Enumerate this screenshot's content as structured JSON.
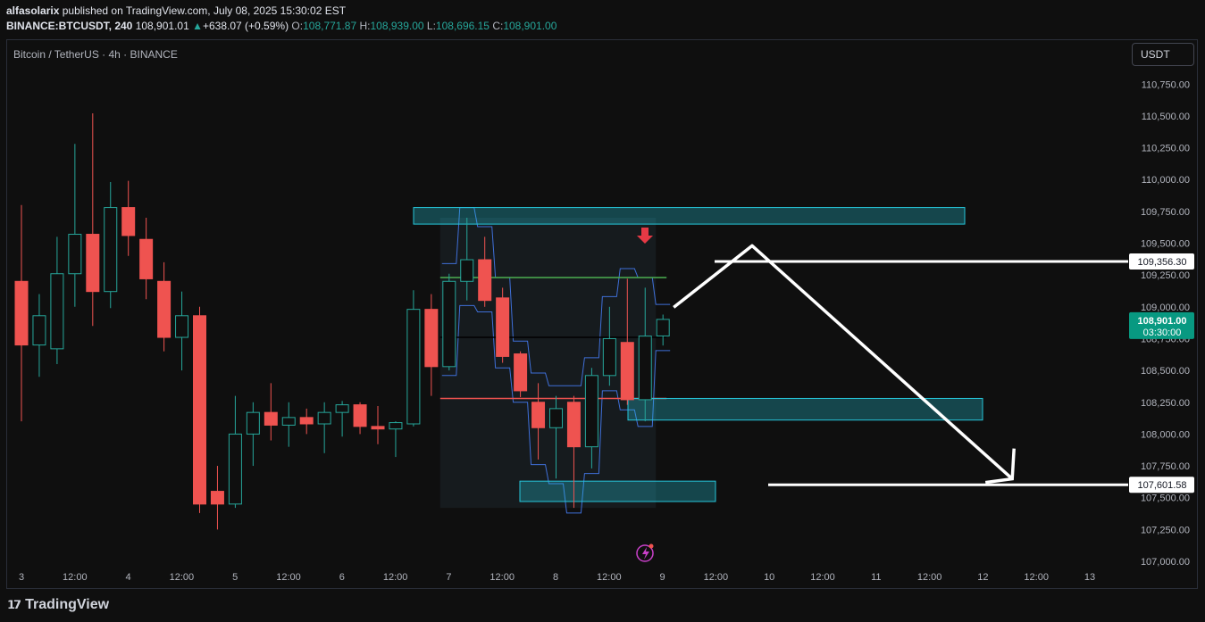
{
  "header": {
    "author": "alfasolarix",
    "published": "published on TradingView.com, July 08, 2025 15:30:02 EST",
    "symbol": "BINANCE:BTCUSDT, 240",
    "last": "108,901.01",
    "change": "+638.07 (+0.59%)",
    "o_label": "O:",
    "o": "108,771.87",
    "h_label": "H:",
    "h": "108,939.00",
    "l_label": "L:",
    "l": "108,696.15",
    "c_label": "C:",
    "c": "108,901.00"
  },
  "symbol_title": "Bitcoin / TetherUS · 4h · BINANCE",
  "currency_button": "USDT",
  "footer": {
    "brand": "TradingView"
  },
  "colors": {
    "up": "#26a69a",
    "down": "#ef5350",
    "zone": "#26c6da",
    "arrow": "#ffffff"
  },
  "chart_data": {
    "type": "candlestick",
    "ylim": [
      107000,
      110850
    ],
    "y_ticks": [
      107000,
      107250,
      107500,
      107750,
      108000,
      108250,
      108500,
      108750,
      109000,
      109250,
      109500,
      109750,
      110000,
      110250,
      110500,
      110750
    ],
    "y_tick_labels": [
      "107,000.00",
      "107,250.00",
      "107,500.00",
      "107,750.00",
      "108,000.00",
      "108,250.00",
      "108,500.00",
      "108,750.00",
      "109,000.00",
      "109,250.00",
      "109,500.00",
      "109,750.00",
      "110,000.00",
      "110,250.00",
      "110,500.00",
      "110,750.00"
    ],
    "x_ticks": [
      "3",
      "12:00",
      "4",
      "12:00",
      "5",
      "12:00",
      "6",
      "12:00",
      "7",
      "12:00",
      "8",
      "12:00",
      "9",
      "12:00",
      "10",
      "12:00",
      "11",
      "12:00",
      "12",
      "12:00",
      "13"
    ],
    "candles": [
      {
        "o": 109200,
        "h": 109800,
        "l": 108100,
        "c": 108700
      },
      {
        "o": 108700,
        "h": 109100,
        "l": 108450,
        "c": 108930
      },
      {
        "o": 108670,
        "h": 109550,
        "l": 108550,
        "c": 109260
      },
      {
        "o": 109260,
        "h": 110280,
        "l": 109000,
        "c": 109570
      },
      {
        "o": 109570,
        "h": 110520,
        "l": 108850,
        "c": 109120
      },
      {
        "o": 109120,
        "h": 109980,
        "l": 108990,
        "c": 109780
      },
      {
        "o": 109780,
        "h": 109990,
        "l": 109400,
        "c": 109560
      },
      {
        "o": 109530,
        "h": 109700,
        "l": 109060,
        "c": 109220
      },
      {
        "o": 109200,
        "h": 109350,
        "l": 108650,
        "c": 108760
      },
      {
        "o": 108760,
        "h": 109120,
        "l": 108500,
        "c": 108930
      },
      {
        "o": 108930,
        "h": 109000,
        "l": 107380,
        "c": 107450
      },
      {
        "o": 107550,
        "h": 107750,
        "l": 107250,
        "c": 107450
      },
      {
        "o": 107450,
        "h": 108300,
        "l": 107420,
        "c": 108000
      },
      {
        "o": 108000,
        "h": 108250,
        "l": 107750,
        "c": 108170
      },
      {
        "o": 108170,
        "h": 108400,
        "l": 107950,
        "c": 108070
      },
      {
        "o": 108070,
        "h": 108250,
        "l": 107900,
        "c": 108130
      },
      {
        "o": 108130,
        "h": 108200,
        "l": 108000,
        "c": 108080
      },
      {
        "o": 108080,
        "h": 108250,
        "l": 107850,
        "c": 108170
      },
      {
        "o": 108170,
        "h": 108260,
        "l": 107980,
        "c": 108230
      },
      {
        "o": 108230,
        "h": 108250,
        "l": 108000,
        "c": 108060
      },
      {
        "o": 108060,
        "h": 108220,
        "l": 107920,
        "c": 108040
      },
      {
        "o": 108040,
        "h": 108100,
        "l": 107820,
        "c": 108090
      },
      {
        "o": 108080,
        "h": 109130,
        "l": 108060,
        "c": 108980
      },
      {
        "o": 108980,
        "h": 109100,
        "l": 108300,
        "c": 108530
      },
      {
        "o": 108530,
        "h": 109260,
        "l": 108500,
        "c": 109200
      },
      {
        "o": 109200,
        "h": 109700,
        "l": 109050,
        "c": 109370
      },
      {
        "o": 109370,
        "h": 109550,
        "l": 109000,
        "c": 109050
      },
      {
        "o": 109070,
        "h": 109150,
        "l": 108560,
        "c": 108610
      },
      {
        "o": 108630,
        "h": 108650,
        "l": 108290,
        "c": 108340
      },
      {
        "o": 108250,
        "h": 108400,
        "l": 107800,
        "c": 108050
      },
      {
        "o": 108050,
        "h": 108300,
        "l": 107650,
        "c": 108200
      },
      {
        "o": 108250,
        "h": 108300,
        "l": 107420,
        "c": 107900
      },
      {
        "o": 107900,
        "h": 108520,
        "l": 107730,
        "c": 108460
      },
      {
        "o": 108460,
        "h": 109000,
        "l": 108380,
        "c": 108750
      },
      {
        "o": 108720,
        "h": 109220,
        "l": 108230,
        "c": 108270
      },
      {
        "o": 108270,
        "h": 109150,
        "l": 108100,
        "c": 108770
      },
      {
        "o": 108771,
        "h": 108939,
        "l": 108696,
        "c": 108901
      }
    ],
    "zones": [
      {
        "top": 109780,
        "bottom": 109650
      },
      {
        "top": 108280,
        "bottom": 108110
      },
      {
        "top": 107630,
        "bottom": 107470
      }
    ],
    "lines": [
      {
        "y": 109230,
        "color": "#4caf50"
      },
      {
        "y": 108760,
        "color": "#000000"
      },
      {
        "y": 108280,
        "color": "#ef5350"
      }
    ],
    "price_labels": [
      {
        "value": 109356.3,
        "text": "109,356.30"
      },
      {
        "value": 107601.58,
        "text": "107,601.58"
      }
    ],
    "current_price": {
      "value": 108901.0,
      "text": "108,901.00",
      "countdown": "03:30:00"
    },
    "projection": [
      {
        "candle": 36,
        "y": 108940
      },
      {
        "candle": 41,
        "y": 109480
      },
      {
        "candle": 56,
        "y": 107620
      }
    ]
  }
}
